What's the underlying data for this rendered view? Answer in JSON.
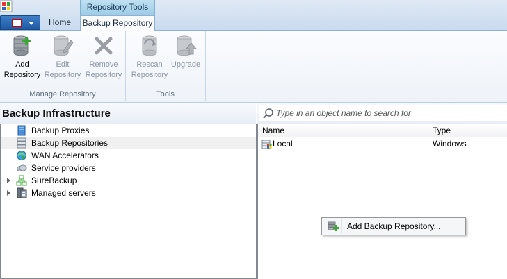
{
  "tabs": {
    "context_group": "Repository Tools",
    "home": "Home",
    "backup_repository": "Backup Repository"
  },
  "ribbon": {
    "manage_group": {
      "label": "Manage Repository",
      "add": {
        "line1": "Add",
        "line2": "Repository"
      },
      "edit": {
        "line1": "Edit",
        "line2": "Repository"
      },
      "remove": {
        "line1": "Remove",
        "line2": "Repository"
      }
    },
    "tools_group": {
      "label": "Tools",
      "rescan": {
        "line1": "Rescan",
        "line2": "Repository"
      },
      "upgrade": {
        "line1": "Upgrade"
      }
    }
  },
  "left_pane": {
    "title": "Backup Infrastructure",
    "items": [
      {
        "label": "Backup Proxies",
        "icon": "backup-proxy-icon"
      },
      {
        "label": "Backup Repositories",
        "icon": "backup-repository-icon"
      },
      {
        "label": "WAN Accelerators",
        "icon": "wan-accelerator-icon"
      },
      {
        "label": "Service providers",
        "icon": "cloud-icon"
      },
      {
        "label": "SureBackup",
        "icon": "surebackup-icon"
      },
      {
        "label": "Managed servers",
        "icon": "managed-servers-icon"
      }
    ]
  },
  "search": {
    "placeholder": "Type in an object name to search for"
  },
  "grid": {
    "columns": {
      "name": "Name",
      "type": "Type"
    },
    "rows": [
      {
        "name": "Local",
        "type": "Windows"
      }
    ]
  },
  "context_menu": {
    "add_backup_repository": "Add Backup Repository..."
  },
  "colors": {
    "accent_blue": "#1f5aa3",
    "tab_highlight": "#9fcde6",
    "add_green": "#3aa832",
    "disabled_text": "#8c96a3"
  }
}
